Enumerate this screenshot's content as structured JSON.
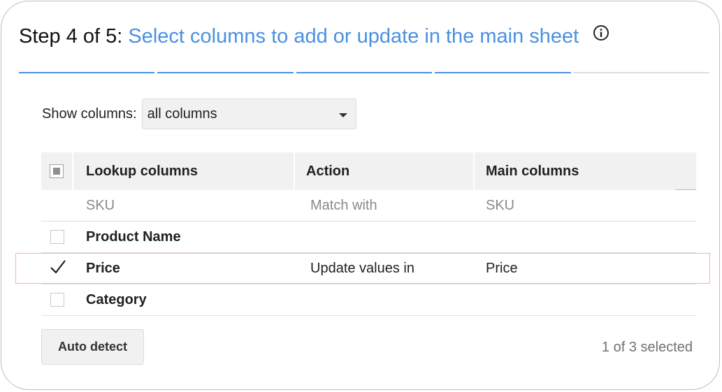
{
  "header": {
    "step_prefix": "Step 4 of 5:",
    "title": "Select columns to add or update in the main sheet",
    "info_icon": "info-icon"
  },
  "progress": {
    "completed_steps": 4,
    "total_steps": 5,
    "accent_color": "#4a90e2"
  },
  "filter": {
    "label": "Show columns:",
    "selected": "all columns"
  },
  "table": {
    "headers": {
      "lookup": "Lookup columns",
      "action": "Action",
      "main": "Main columns"
    },
    "select_all_state": "indeterminate",
    "rows": [
      {
        "lookup": "SKU",
        "action": "Match with",
        "main": "SKU",
        "checkbox": "none",
        "muted": true
      },
      {
        "lookup": "Product Name",
        "action": "",
        "main": "",
        "checkbox": "unchecked"
      },
      {
        "lookup": "Price",
        "action": "Update values in",
        "main": "Price",
        "checkbox": "checked",
        "highlighted": true
      },
      {
        "lookup": "Category",
        "action": "",
        "main": "",
        "checkbox": "unchecked"
      }
    ]
  },
  "footer": {
    "auto_detect_label": "Auto detect",
    "selection_status": "1 of 3 selected"
  },
  "colors": {
    "highlight_border": "#f4a6f0",
    "header_bg": "#f1f1f1"
  }
}
